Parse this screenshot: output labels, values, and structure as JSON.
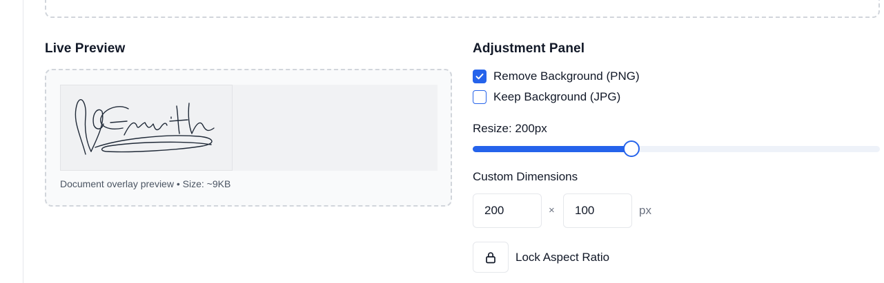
{
  "preview": {
    "title": "Live Preview",
    "caption": "Document overlay preview • Size: ~9KB"
  },
  "panel": {
    "title": "Adjustment Panel",
    "options": [
      {
        "label": "Remove Background (PNG)",
        "checked": true
      },
      {
        "label": "Keep Background (JPG)",
        "checked": false
      }
    ],
    "resize": {
      "label": "Resize: 200px",
      "fraction": 0.39
    },
    "dimensions": {
      "label": "Custom Dimensions",
      "width": "200",
      "height": "100",
      "times": "×",
      "unit": "px"
    },
    "lock": {
      "label": "Lock Aspect Ratio",
      "icon": "lock-icon"
    }
  },
  "colors": {
    "accent": "#2563eb",
    "text": "#111827",
    "muted": "#6b7280",
    "border": "#e5e7eb",
    "dashed_border": "#d1d5db"
  }
}
